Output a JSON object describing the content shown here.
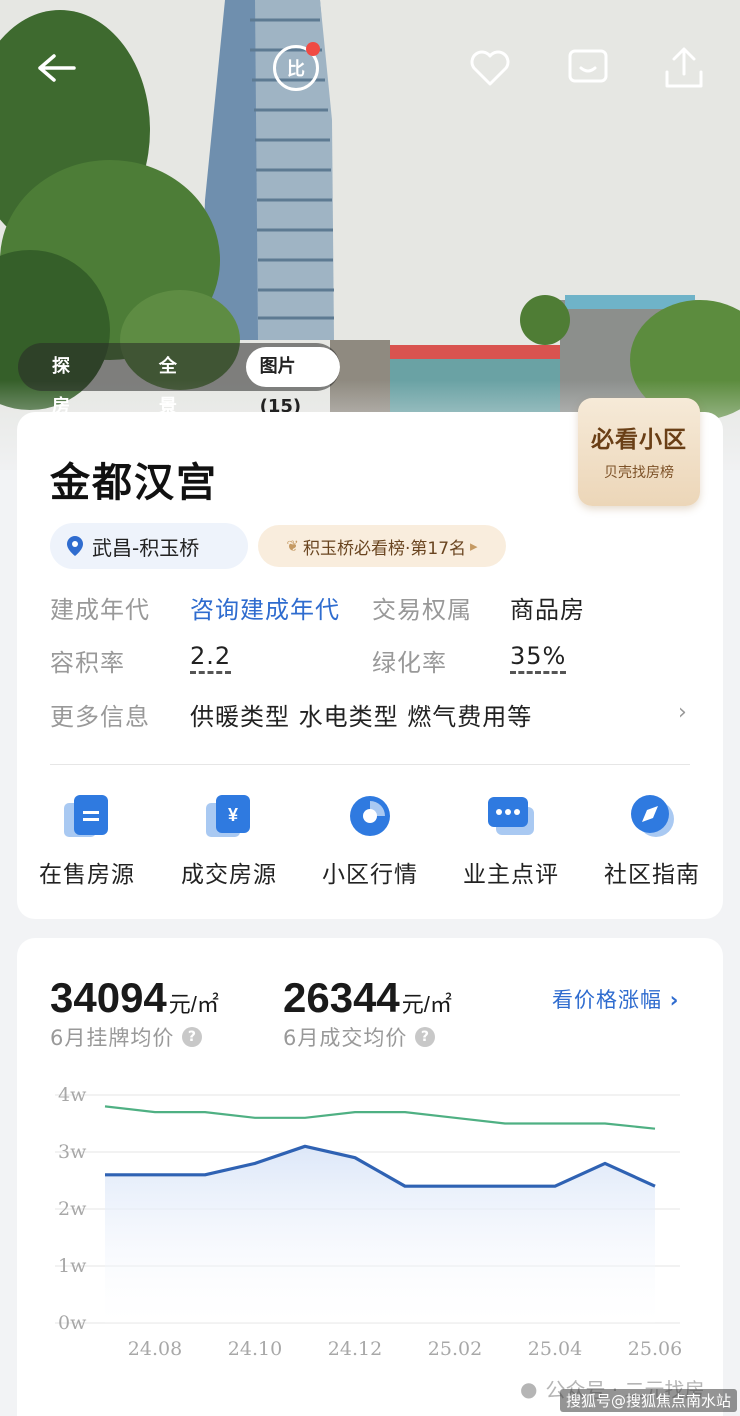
{
  "hero": {
    "compare_label": "比",
    "tabs": [
      {
        "label": "探房",
        "active": false
      },
      {
        "label": "全景",
        "active": false
      },
      {
        "label": "图片(15)",
        "active": true
      }
    ]
  },
  "badge": {
    "title": "必看小区",
    "subtitle": "贝壳找房榜"
  },
  "community": {
    "name": "金都汉宫",
    "location": "武昌-积玉桥",
    "rank": "积玉桥必看榜·第17名"
  },
  "attributes": [
    {
      "label": "建成年代",
      "value": "咨询建成年代"
    },
    {
      "label": "交易权属",
      "value": "商品房"
    },
    {
      "label": "容积率",
      "value": "2.2"
    },
    {
      "label": "绿化率",
      "value": "35%"
    },
    {
      "label": "更多信息",
      "value": "供暖类型 水电类型 燃气费用等"
    }
  ],
  "quick_links": [
    {
      "label": "在售房源",
      "icon": "document-icon"
    },
    {
      "label": "成交房源",
      "icon": "yuan-icon"
    },
    {
      "label": "小区行情",
      "icon": "pie-chart-icon"
    },
    {
      "label": "业主点评",
      "icon": "comment-icon"
    },
    {
      "label": "社区指南",
      "icon": "compass-icon"
    }
  ],
  "prices": {
    "listing": {
      "value": "34094",
      "unit": "元/㎡",
      "label": "6月挂牌均价"
    },
    "deal": {
      "value": "26344",
      "unit": "元/㎡",
      "label": "6月成交均价"
    },
    "trend_link": "看价格涨幅"
  },
  "colors": {
    "accent": "#2f6ccf",
    "listing_line": "#4fb083",
    "deal_line": "#2f62b3"
  },
  "chart_data": {
    "type": "line",
    "x": [
      "24.07",
      "24.08",
      "24.09",
      "24.10",
      "24.11",
      "24.12",
      "25.01",
      "25.02",
      "25.03",
      "25.04",
      "25.05",
      "25.06"
    ],
    "x_tick_labels": [
      "24.08",
      "24.10",
      "24.12",
      "25.02",
      "25.04",
      "25.06"
    ],
    "y_tick_labels": [
      "0w",
      "1w",
      "2w",
      "3w",
      "4w"
    ],
    "ylim": [
      0,
      40000
    ],
    "grid": true,
    "series": [
      {
        "values": [
          38000,
          37000,
          37000,
          36000,
          36000,
          37000,
          37000,
          36000,
          35000,
          35000,
          35000,
          34094
        ]
      },
      {
        "values": [
          26000,
          26000,
          26000,
          28000,
          31000,
          29000,
          24000,
          24000,
          24000,
          24000,
          28000,
          24000
        ],
        "area": true
      }
    ]
  },
  "footer": {
    "watermark": "公众号 · 二元找房",
    "source": "搜狐号@搜狐焦点南水站"
  }
}
